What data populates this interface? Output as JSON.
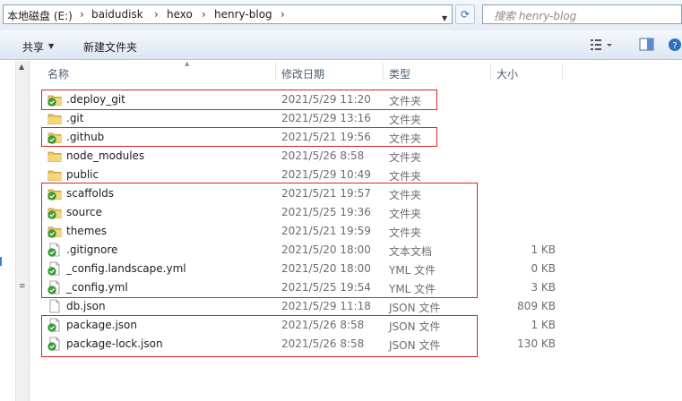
{
  "address": {
    "crumbs": [
      "本地磁盘 (E:)",
      "baidudisk",
      "hexo",
      "henry-blog"
    ],
    "separator": "›"
  },
  "search": {
    "placeholder": "搜索 henry-blog"
  },
  "toolbar": {
    "share_label": "共享",
    "new_folder_label": "新建文件夹"
  },
  "columns": {
    "name": "名称",
    "date": "修改日期",
    "type": "类型",
    "size": "大小"
  },
  "files": [
    {
      "name": ".deploy_git",
      "date": "2021/5/29 11:20",
      "type": "文件夹",
      "size": "",
      "icon": "folder-sync-icon"
    },
    {
      "name": ".git",
      "date": "2021/5/29 13:16",
      "type": "文件夹",
      "size": "",
      "icon": "folder-icon"
    },
    {
      "name": ".github",
      "date": "2021/5/21 19:56",
      "type": "文件夹",
      "size": "",
      "icon": "folder-sync-icon"
    },
    {
      "name": "node_modules",
      "date": "2021/5/26 8:58",
      "type": "文件夹",
      "size": "",
      "icon": "folder-icon"
    },
    {
      "name": "public",
      "date": "2021/5/29 10:49",
      "type": "文件夹",
      "size": "",
      "icon": "folder-icon"
    },
    {
      "name": "scaffolds",
      "date": "2021/5/21 19:57",
      "type": "文件夹",
      "size": "",
      "icon": "folder-sync-icon"
    },
    {
      "name": "source",
      "date": "2021/5/25 19:36",
      "type": "文件夹",
      "size": "",
      "icon": "folder-sync-icon"
    },
    {
      "name": "themes",
      "date": "2021/5/21 19:59",
      "type": "文件夹",
      "size": "",
      "icon": "folder-sync-icon"
    },
    {
      "name": ".gitignore",
      "date": "2021/5/20 18:00",
      "type": "文本文档",
      "size": "1 KB",
      "icon": "file-sync-icon"
    },
    {
      "name": "_config.landscape.yml",
      "date": "2021/5/20 18:00",
      "type": "YML 文件",
      "size": "0 KB",
      "icon": "file-sync-icon"
    },
    {
      "name": "_config.yml",
      "date": "2021/5/25 19:54",
      "type": "YML 文件",
      "size": "3 KB",
      "icon": "file-sync-icon"
    },
    {
      "name": "db.json",
      "date": "2021/5/29 11:18",
      "type": "JSON 文件",
      "size": "809 KB",
      "icon": "file-icon"
    },
    {
      "name": "package.json",
      "date": "2021/5/26 8:58",
      "type": "JSON 文件",
      "size": "1 KB",
      "icon": "file-sync-icon"
    },
    {
      "name": "package-lock.json",
      "date": "2021/5/26 8:58",
      "type": "JSON 文件",
      "size": "130 KB",
      "icon": "file-sync-icon"
    }
  ],
  "colors": {
    "highlight": "#d9232e",
    "folder": "#e8c45a",
    "sync_badge": "#3aa335"
  }
}
